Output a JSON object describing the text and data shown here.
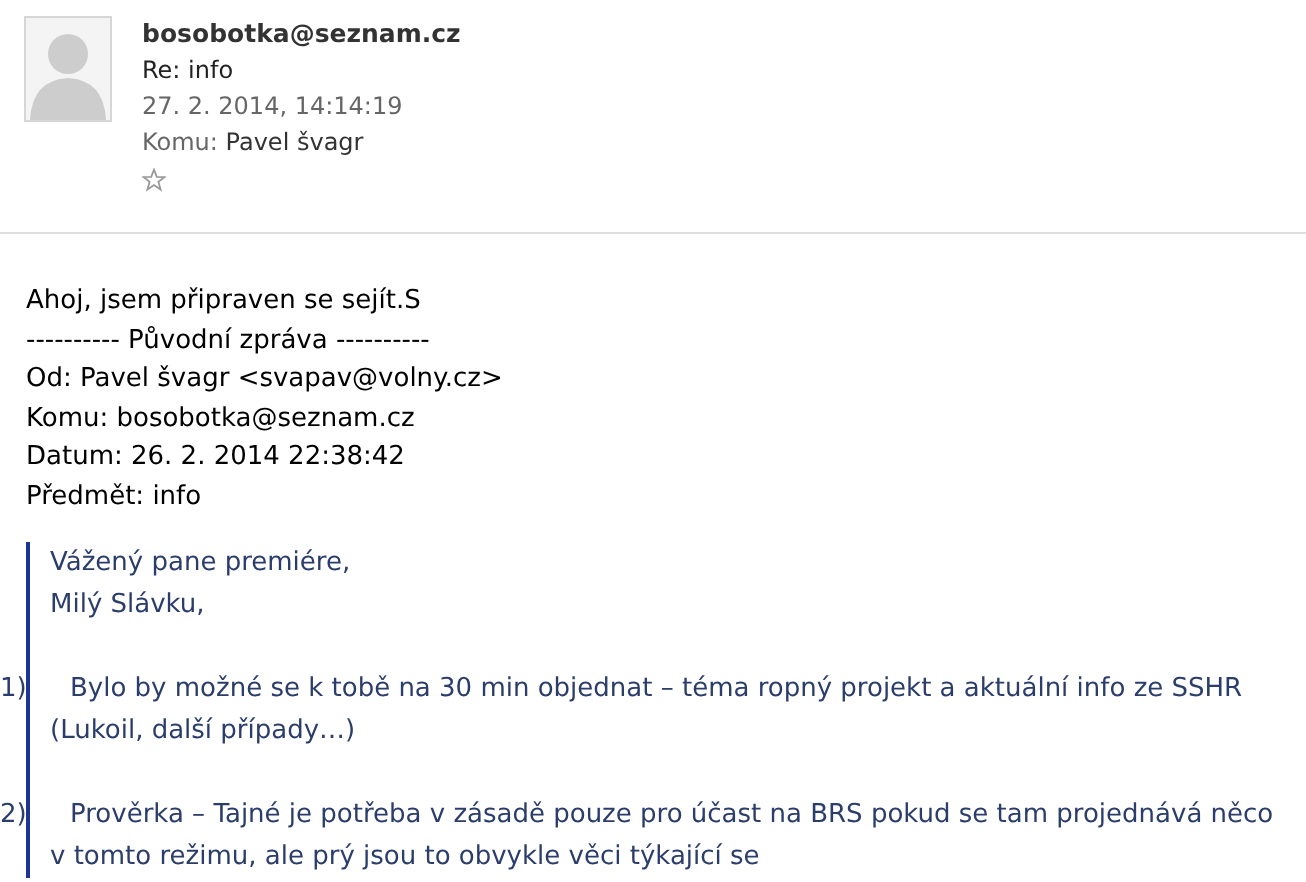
{
  "header": {
    "sender": "bosobotka@seznam.cz",
    "subject": "Re: info",
    "date": "27. 2. 2014, 14:14:19",
    "to_label": "Komu:",
    "to_name": "Pavel švagr",
    "starred": false
  },
  "body": [
    "Ahoj, jsem připraven se sejít.S",
    "---------- Původní zpráva ----------",
    "Od: Pavel švagr <svapav@volny.cz>",
    "Komu: bosobotka@seznam.cz",
    "Datum: 26. 2. 2014 22:38:42",
    "Předmět: info"
  ],
  "quote": {
    "greeting": [
      "Vážený pane premiére,",
      "Milý Slávku,"
    ],
    "items": [
      {
        "number": "1)",
        "text": "Bylo by možné se k tobě na 30 min objednat – téma ropný projekt a aktuální info ze SSHR (Lukoil, další případy…)"
      },
      {
        "number": "2)",
        "text": "Prověrka – Tajné je potřeba v zásadě pouze pro účast na BRS pokud se tam projednává něco v tomto režimu, ale prý jsou to obvykle věci týkající se"
      }
    ]
  }
}
